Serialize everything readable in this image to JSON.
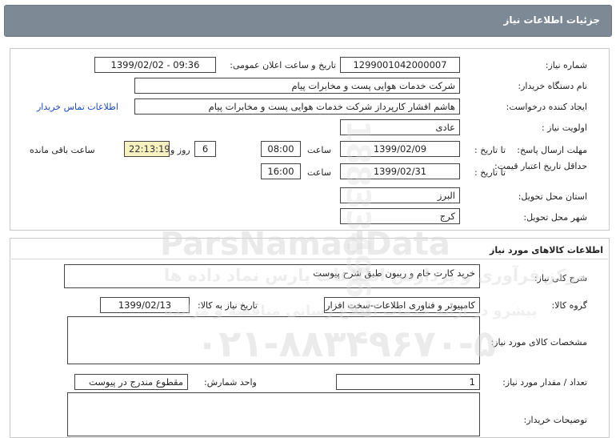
{
  "header": {
    "title": "جزئیات اطلاعات نیاز"
  },
  "info": {
    "need_number_label": "شماره نیاز:",
    "need_number": "1299001042000007",
    "announce_label": "تاریخ و ساعت اعلان عمومی:",
    "announce_value": "1399/02/02 - 09:36",
    "buyer_org_label": "نام دستگاه خریدار:",
    "buyer_org": "شرکت خدمات هوایی پست و مخابرات پیام",
    "creator_label": "ایجاد کننده درخواست:",
    "creator": "هاشم افشار کارپرداز شرکت خدمات هوایی پست و مخابرات پیام",
    "contact_link": "اطلاعات تماس خریدار",
    "priority_label": "اولویت نیاز :",
    "priority": "عادی",
    "reply_deadline_label": "مهلت ارسال پاسخ:",
    "until_date_label": "تا تاریخ :",
    "reply_date": "1399/02/09",
    "hour_label": "ساعت",
    "reply_time": "08:00",
    "days": "6",
    "days_label": "روز و",
    "remaining_time": "22:13:19",
    "remaining_label": "ساعت باقی مانده",
    "min_validity_label": "حداقل تاریخ اعتبار قیمت:",
    "validity_until_label": "تا تاریخ :",
    "validity_date": "1399/02/31",
    "validity_hour_label": "ساعت",
    "validity_time": "16:00",
    "province_label": "استان محل تحویل:",
    "province": "البرز",
    "city_label": "شهر محل تحویل:",
    "city": "کرج"
  },
  "goods": {
    "section_title": "اطلاعات کالاهای مورد نیاز",
    "summary_label": "شرح کلی نیاز:",
    "summary": "خرید کارت خام و ریبون طبق شرح پیوست",
    "group_label": "گروه کالا:",
    "group": "کامپیوتر و فناوری اطلاعات-سخت افزار",
    "need_date_label": "تاریخ نیاز به کالا:",
    "need_date": "1399/02/13",
    "specs_label": "مشخصات کالای مورد نیاز:",
    "specs": "",
    "qty_label": "تعداد / مقدار مورد نیاز:",
    "qty": "1",
    "unit_label": "واحد شمارش:",
    "unit": "مقطوع مندرج در پیوست",
    "buyer_notes_label": "توضیحات خریدار:",
    "buyer_notes": ""
  },
  "watermark": {
    "brand": "ParsNamadData",
    "tagline": "مرکز فرآوری و پردازش اطلاعات پارس نماد داده ها",
    "tagline2": "پیشرو در ارائه خدمات اطلاع رسانی مناقصه و مزایده",
    "phone": "۰۲۱-۸۸۳۴۹۶۷۰-۵",
    "vertical": "188334967"
  },
  "colors": {
    "header_bg": "#7d8a96",
    "link": "#1a49b8",
    "timer_bg": "#f5f2c0"
  }
}
